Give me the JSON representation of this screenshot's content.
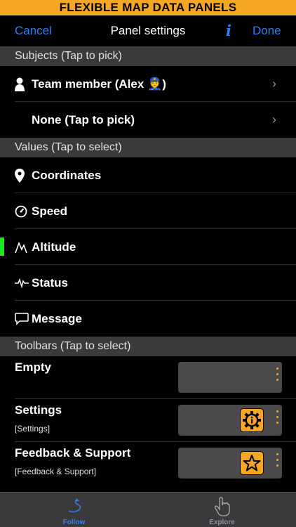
{
  "banner": {
    "text": "FLEXIBLE MAP DATA PANELS"
  },
  "nav": {
    "cancel": "Cancel",
    "title": "Panel settings",
    "info": "i",
    "done": "Done"
  },
  "subjects": {
    "header": "Subjects (Tap to pick)",
    "items": [
      {
        "label": "Team member (Alex 👮)",
        "icon": "person-icon"
      },
      {
        "label": "None (Tap to pick)",
        "icon": ""
      }
    ]
  },
  "values": {
    "header": "Values (Tap to select)",
    "items": [
      {
        "label": "Coordinates",
        "icon": "location-pin-icon"
      },
      {
        "label": "Speed",
        "icon": "speedometer-icon"
      },
      {
        "label": "Altitude",
        "icon": "mountain-icon"
      },
      {
        "label": "Status",
        "icon": "pulse-icon"
      },
      {
        "label": "Message",
        "icon": "speech-bubble-icon"
      }
    ]
  },
  "toolbars": {
    "header": "Toolbars (Tap to select)",
    "items": [
      {
        "title": "Empty",
        "subtitle": "",
        "button_icon": ""
      },
      {
        "title": "Settings",
        "subtitle": "[Settings]",
        "button_icon": "gear-info-icon"
      },
      {
        "title": "Feedback & Support",
        "subtitle": "[Feedback & Support]",
        "button_icon": "star-icon"
      }
    ]
  },
  "tabbar": {
    "tabs": [
      {
        "label": "Follow",
        "icon": "follow-path-icon",
        "active": true
      },
      {
        "label": "Explore",
        "icon": "hand-pointer-icon",
        "active": false
      }
    ]
  },
  "colors": {
    "accent": "#2f7ff0",
    "banner": "#f5a623",
    "highlight": "#1ee91e"
  }
}
